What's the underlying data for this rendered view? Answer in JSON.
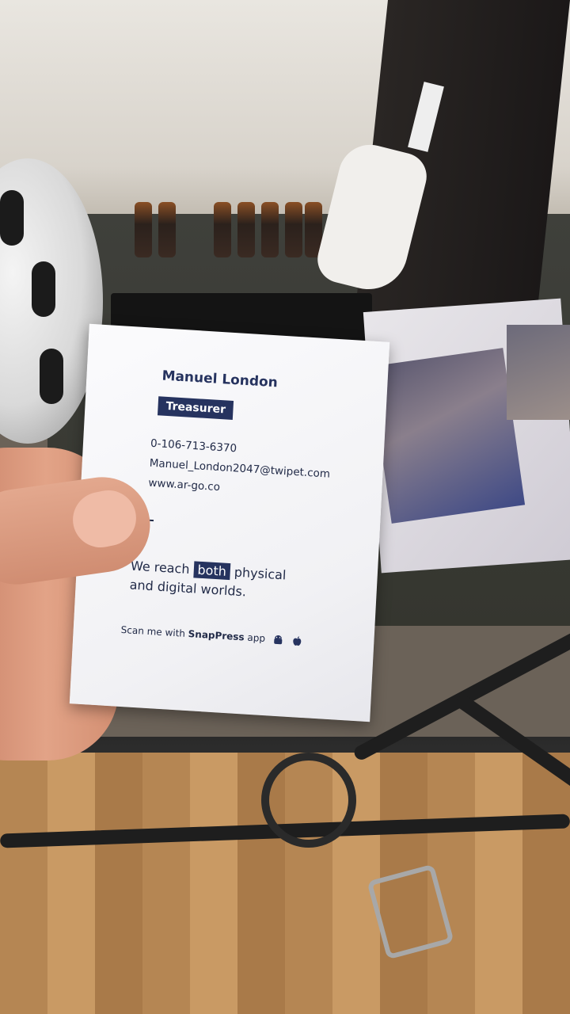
{
  "card": {
    "name": "Manuel London",
    "title": "Treasurer",
    "phone": "0-106-713-6370",
    "email": "Manuel_London2047@twipet.com",
    "website": "www.ar-go.co",
    "tagline": {
      "before": "We reach",
      "highlight": "both",
      "after": "physical",
      "line2": "and digital worlds."
    },
    "scan": {
      "prefix": "Scan me with",
      "app": "SnapPress",
      "suffix": "app"
    },
    "icons": [
      "android-icon",
      "apple-icon"
    ],
    "accent_color": "#26335f"
  }
}
